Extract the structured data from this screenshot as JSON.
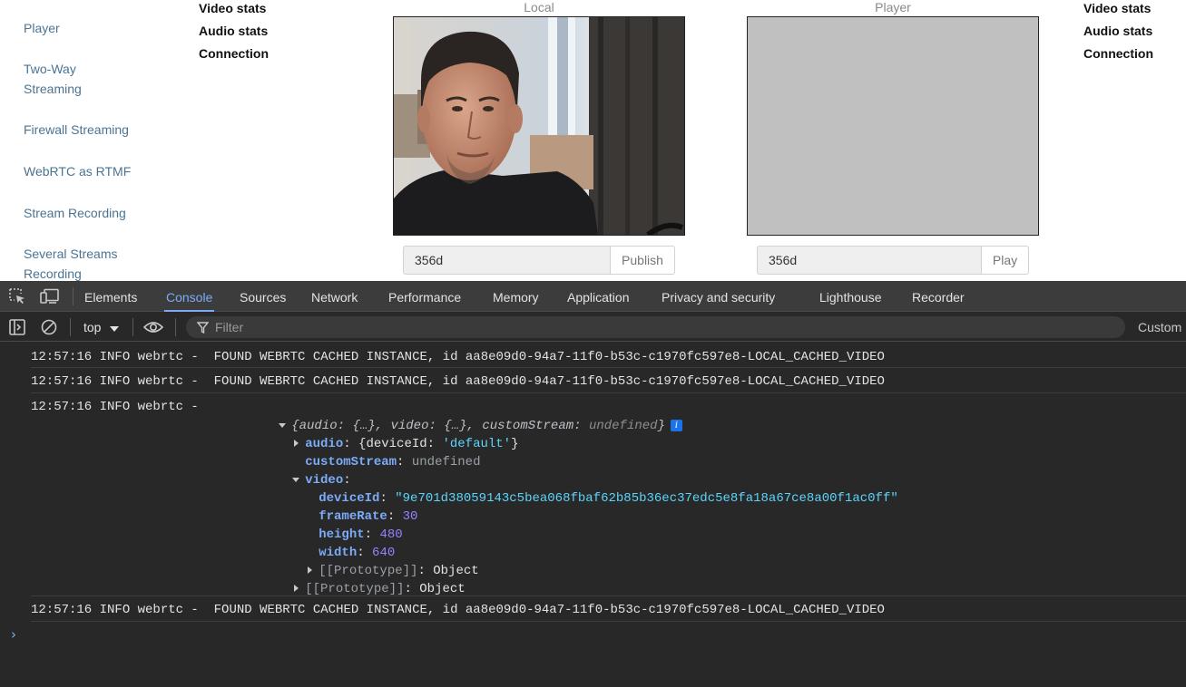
{
  "nav": {
    "items": [
      {
        "label": "Player"
      },
      {
        "label": "Two-Way"
      },
      {
        "label": "Streaming"
      },
      {
        "label": "Firewall Streaming"
      },
      {
        "label": "WebRTC as RTMF"
      },
      {
        "label": "Stream Recording"
      },
      {
        "label": "Several Streams"
      },
      {
        "label": "Recording"
      }
    ]
  },
  "publisher": {
    "stats": {
      "video": "Video stats",
      "audio": "Audio stats",
      "connection": "Connection"
    },
    "video_label": "Local",
    "stream_name": "356d",
    "button_label": "Publish"
  },
  "player": {
    "stats": {
      "video": "Video stats",
      "audio": "Audio stats",
      "connection": "Connection"
    },
    "video_label": "Player",
    "stream_name": "356d",
    "button_label": "Play",
    "video_background": "#c0c0c0"
  },
  "devtools": {
    "tabs": [
      "Elements",
      "Console",
      "Sources",
      "Network",
      "Performance",
      "Memory",
      "Application",
      "Privacy and security",
      "Lighthouse",
      "Recorder"
    ],
    "active_tab": "Console",
    "toolbar": {
      "context": "top",
      "filter_placeholder": "Filter",
      "levels": "Custom"
    },
    "icons": [
      "inspect-element-icon",
      "device-toolbar-icon",
      "sidebar-toggle-icon",
      "clear-console-icon",
      "eye-icon",
      "filter-icon",
      "chevron-down-icon",
      "prompt-chevron-icon"
    ],
    "accent_color": "#7cacf8"
  },
  "console": {
    "log1": {
      "prefix": "12:57:16 INFO webrtc -  ",
      "message": "FOUND WEBRTC CACHED INSTANCE, id aa8e09d0-94a7-11f0-b53c-c1970fc597e8-LOCAL_CACHED_VIDEO"
    },
    "log2": {
      "prefix": "12:57:16 INFO webrtc -  ",
      "message": "FOUND WEBRTC CACHED INSTANCE, id aa8e09d0-94a7-11f0-b53c-c1970fc597e8-LOCAL_CACHED_VIDEO"
    },
    "log3": {
      "prefix": "12:57:16 INFO webrtc -",
      "object": {
        "summary_open": "{",
        "summary_audio": "audio: ",
        "summary_audio_val": "{…}",
        "summary_sep1": ", ",
        "summary_video": "video: ",
        "summary_video_val": "{…}",
        "summary_sep2": ", ",
        "summary_custom": "customStream: ",
        "summary_custom_val": "undefined",
        "summary_close": "}",
        "info_badge": "i",
        "audio_key": "audio",
        "audio_preview_open": "{deviceId: ",
        "audio_preview_val": "'default'",
        "audio_preview_close": "}",
        "custom_key": "customStream",
        "custom_val": "undefined",
        "video_key": "video",
        "video_props": [
          {
            "key": "deviceId",
            "value": "\"9e701d38059143c5bea068fbaf62b85b36ec37edc5e8fa18a67ce8a00f1ac0ff\"",
            "type": "string"
          },
          {
            "key": "frameRate",
            "value": "30",
            "type": "number"
          },
          {
            "key": "height",
            "value": "480",
            "type": "number"
          },
          {
            "key": "width",
            "value": "640",
            "type": "number"
          }
        ],
        "proto_key": "[[Prototype]]",
        "proto_val": "Object"
      }
    },
    "log4": {
      "prefix": "12:57:16 INFO webrtc -  ",
      "message": "FOUND WEBRTC CACHED INSTANCE, id aa8e09d0-94a7-11f0-b53c-c1970fc597e8-LOCAL_CACHED_VIDEO"
    }
  }
}
